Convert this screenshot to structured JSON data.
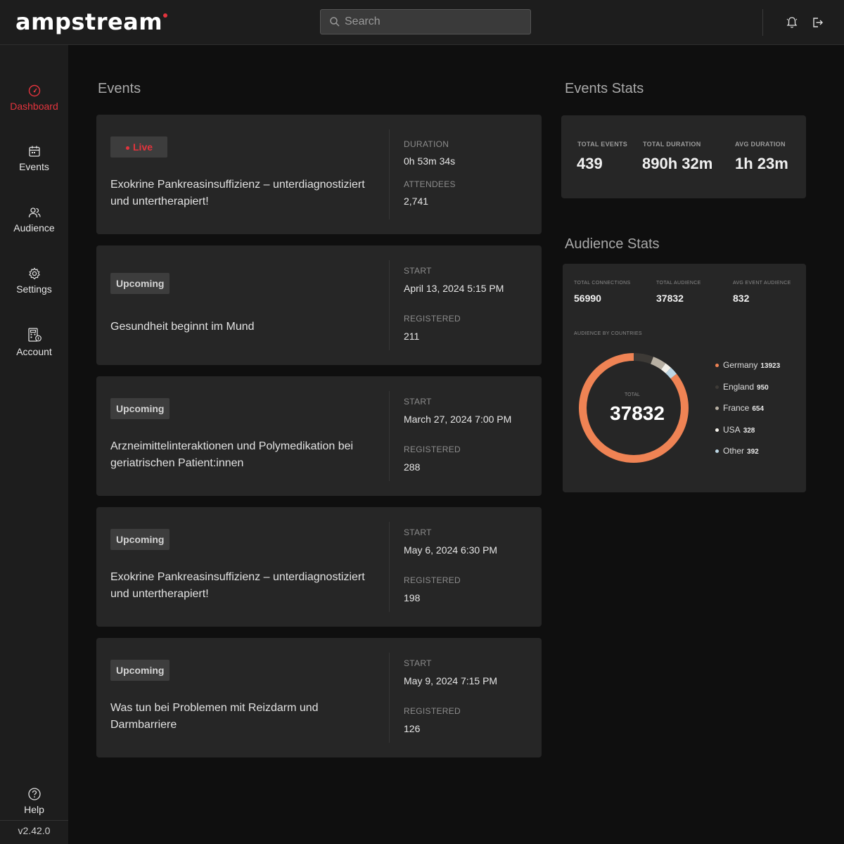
{
  "app": {
    "logo": "ampstream"
  },
  "search": {
    "placeholder": "Search"
  },
  "sidebar": {
    "items": [
      {
        "label": "Dashboard",
        "icon": "dashboard-gauge-icon",
        "active": true
      },
      {
        "label": "Events",
        "icon": "calendar-icon"
      },
      {
        "label": "Audience",
        "icon": "users-icon"
      },
      {
        "label": "Settings",
        "icon": "gear-icon"
      },
      {
        "label": "Account",
        "icon": "account-icon"
      }
    ],
    "help": "Help",
    "version": "v2.42.0"
  },
  "events": {
    "title": "Events",
    "items": [
      {
        "status": "Live",
        "title": "Exokrine Pankreasinsuffizienz – unterdiagnostiziert und untertherapiert!",
        "label1": "DURATION",
        "value1": "0h 53m 34s",
        "label2": "ATTENDEES",
        "value2": "2,741"
      },
      {
        "status": "Upcoming",
        "title": "Gesundheit beginnt im Mund",
        "label1": "START",
        "value1": "April 13, 2024 5:15 PM",
        "label2": "REGISTERED",
        "value2": "211"
      },
      {
        "status": "Upcoming",
        "title": "Arzneimittelinteraktionen und Polymedikation bei geriatrischen Patient:innen",
        "label1": "START",
        "value1": "March 27, 2024 7:00 PM",
        "label2": "REGISTERED",
        "value2": "288"
      },
      {
        "status": "Upcoming",
        "title": "Exokrine Pankreasinsuffizienz – unterdiagnostiziert und untertherapiert!",
        "label1": "START",
        "value1": "May 6, 2024 6:30 PM",
        "label2": "REGISTERED",
        "value2": "198"
      },
      {
        "status": "Upcoming",
        "title": "Was tun bei Problemen mit Reizdarm und Darmbarriere",
        "label1": "START",
        "value1": "May 9, 2024 7:15 PM",
        "label2": "REGISTERED",
        "value2": "126"
      }
    ]
  },
  "event_stats": {
    "title": "Events Stats",
    "total_events_label": "TOTAL EVENTS",
    "total_events": "439",
    "total_duration_label": "TOTAL DURATION",
    "total_duration": "890h 32m",
    "avg_duration_label": "AVG DURATION",
    "avg_duration": "1h 23m"
  },
  "audience_stats": {
    "title": "Audience Stats",
    "total_connections_label": "TOTAL CONNECTIONS",
    "total_connections": "56990",
    "total_audience_label": "TOTAL AUDIENCE",
    "total_audience": "37832",
    "avg_event_audience_label": "AVG EVENT AUDIENCE",
    "avg_event_audience": "832",
    "by_countries_label": "AUDIENCE BY COUNTRIES",
    "donut_total_label": "TOTAL",
    "donut_total": "37832"
  },
  "chart_data": {
    "type": "pie",
    "categories": [
      "Germany",
      "England",
      "France",
      "USA",
      "Other"
    ],
    "values": [
      13923,
      950,
      654,
      328,
      392
    ],
    "colors": [
      "#ef8354",
      "#3d3a36",
      "#b8b0a3",
      "#f4f1ea",
      "#bcd6e4"
    ]
  }
}
